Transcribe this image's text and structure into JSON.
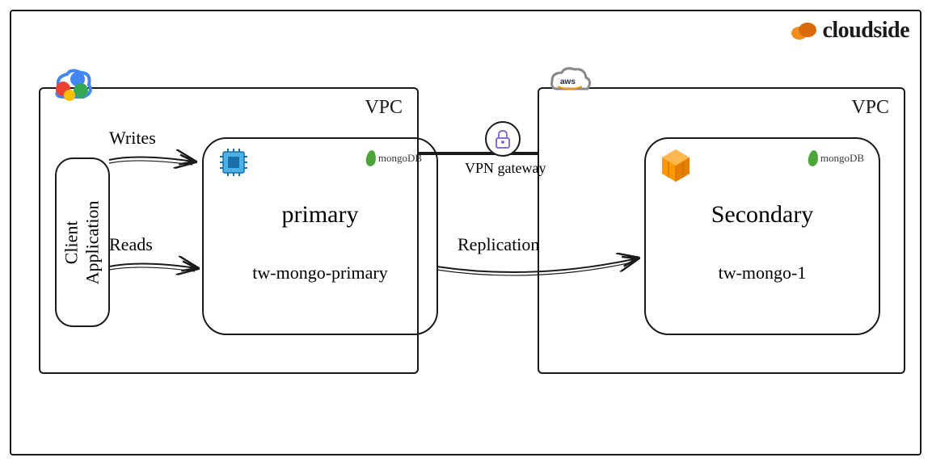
{
  "brand": {
    "name": "cloudside"
  },
  "left_vpc": {
    "label": "VPC",
    "provider": "gcp",
    "client_app": {
      "line1": "Client",
      "line2": "Application"
    },
    "db": {
      "role": "primary",
      "hostname": "tw-mongo-primary",
      "engine": "mongoDB",
      "compute_icon": "gcp-compute-engine"
    }
  },
  "right_vpc": {
    "label": "VPC",
    "provider": "aws",
    "db": {
      "role": "Secondary",
      "hostname": "tw-mongo-1",
      "engine": "mongoDB",
      "compute_icon": "aws-ec2"
    }
  },
  "connections": {
    "writes_label": "Writes",
    "reads_label": "Reads",
    "replication_label": "Replication",
    "vpn_label": "VPN gateway"
  },
  "icons": {
    "gcp": "gcp-cloud-icon",
    "aws": "aws-cloud-icon",
    "lock": "lock-icon",
    "mongo_leaf": "mongo-leaf-icon",
    "brand_cloud": "brand-cloud-icon"
  }
}
